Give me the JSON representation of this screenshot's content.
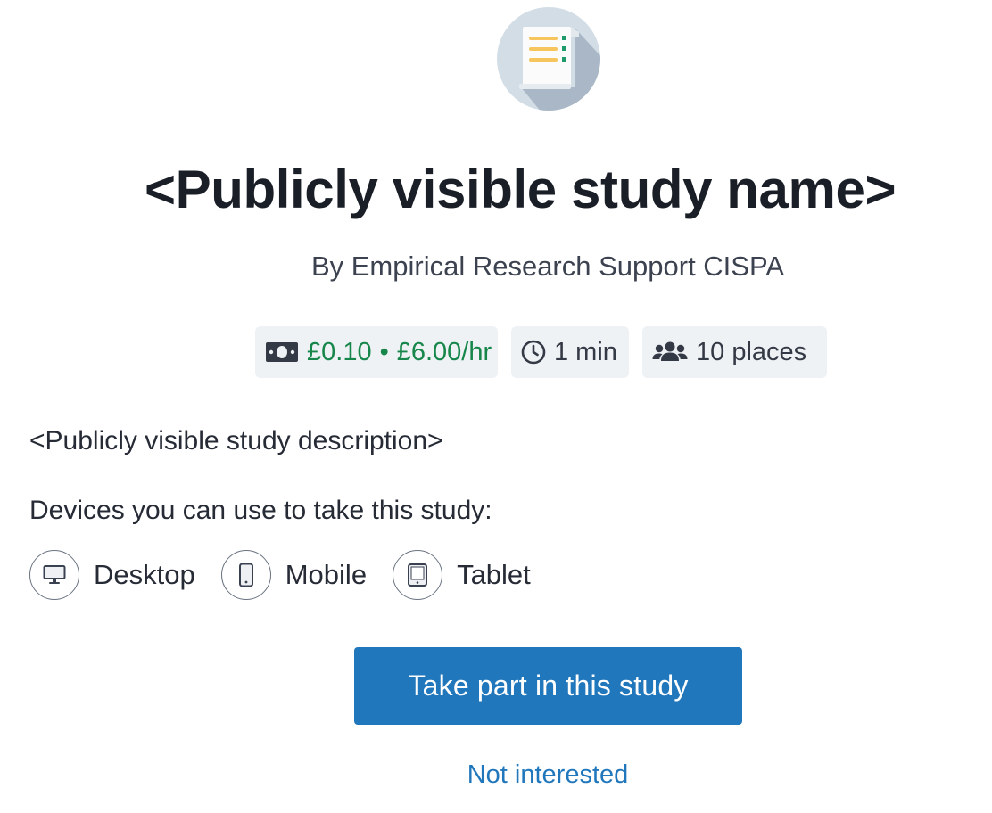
{
  "study": {
    "icon": "document-list-icon",
    "title": "<Publicly visible study name>",
    "byline": "By Empirical Research Support CISPA",
    "description": "<Publicly visible study description>"
  },
  "badges": {
    "pay": {
      "icon": "money-icon",
      "reward": "£0.10",
      "separator": "•",
      "hourly_rate": "£6.00/hr"
    },
    "time": {
      "icon": "clock-icon",
      "label": "1 min"
    },
    "places": {
      "icon": "users-icon",
      "label": "10 places"
    }
  },
  "devices": {
    "heading": "Devices you can use to take this study:",
    "items": [
      {
        "icon": "desktop-icon",
        "label": "Desktop"
      },
      {
        "icon": "mobile-icon",
        "label": "Mobile"
      },
      {
        "icon": "tablet-icon",
        "label": "Tablet"
      }
    ]
  },
  "actions": {
    "take_part_label": "Take part in this study",
    "not_interested_label": "Not interested"
  },
  "colors": {
    "primary": "#2177bc",
    "pay_green": "#17864a",
    "badge_bg": "#eef2f5",
    "text_dark": "#1a1e27"
  }
}
